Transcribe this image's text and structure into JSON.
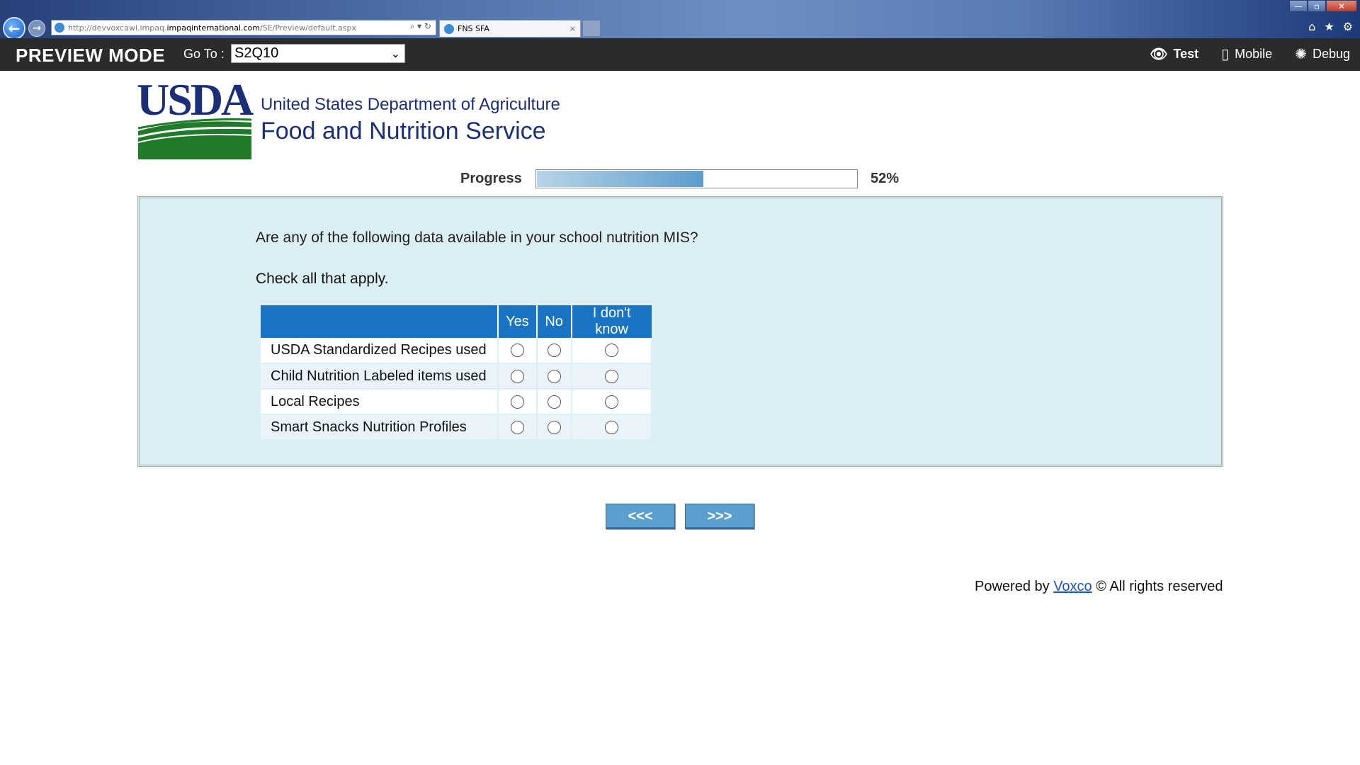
{
  "browser": {
    "url_prefix": "http://devvoxcawi.impaq.",
    "url_domain": "impaqinternational.com",
    "url_path": "/SE/Preview/default.aspx",
    "tab_title": "FNS SFA",
    "tab_close": "×",
    "address_actions": "⌕ ▾ ↻",
    "tools": [
      "⌂",
      "★",
      "⚙"
    ],
    "window_controls": [
      "—",
      "▫",
      "✕"
    ],
    "back_glyph": "←",
    "forward_glyph": "→"
  },
  "preview": {
    "title": "PREVIEW MODE",
    "goto_label": "Go To :",
    "goto_value": "S2Q10",
    "chevron": "⌄",
    "modes": [
      {
        "icon": "eye-icon",
        "glyph": "👁",
        "label": "Test"
      },
      {
        "icon": "mobile-icon",
        "glyph": "▯",
        "label": "Mobile"
      },
      {
        "icon": "bug-icon",
        "glyph": "✺",
        "label": "Debug"
      }
    ]
  },
  "logo": {
    "mark": "USDA",
    "line1": "United States Department of Agriculture",
    "line2": "Food and Nutrition Service",
    "colors": {
      "navy": "#1b2f78",
      "green": "#1f7a2a"
    }
  },
  "progress": {
    "label": "Progress",
    "percent_text": "52%",
    "value": 0.52
  },
  "question": {
    "text": "Are any of the following data available in your school nutrition MIS?",
    "instruction": "Check all that apply.",
    "columns": [
      "Yes",
      "No",
      "I don't know"
    ],
    "rows": [
      "USDA Standardized Recipes used",
      "Child Nutrition Labeled items used",
      "Local Recipes",
      "Smart Snacks Nutrition Profiles"
    ]
  },
  "navigation": {
    "prev_label": "<<<",
    "next_label": ">>>"
  },
  "footer": {
    "prefix": "Powered by",
    "link": "Voxco",
    "suffix": "© All rights reserved"
  },
  "colors": {
    "panel_bg": "#daeef4",
    "header_blue": "#1a74c4",
    "button_blue": "#5b9fd0",
    "preview_bar": "#2b2b2b"
  }
}
